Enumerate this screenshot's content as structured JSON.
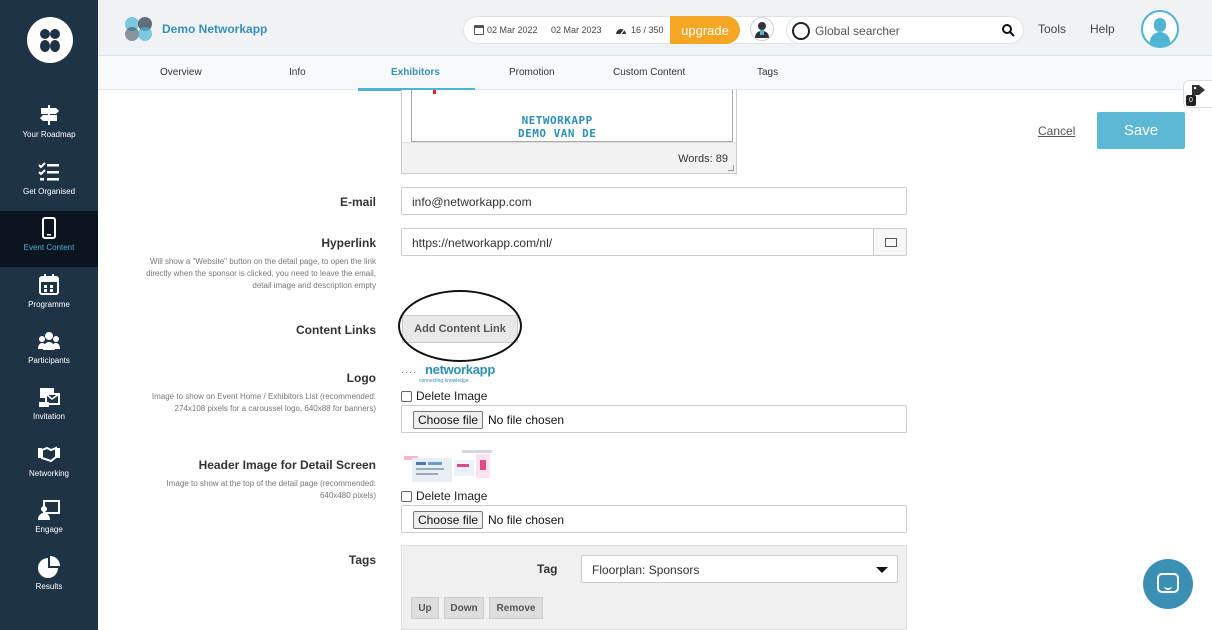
{
  "sidebar": {
    "items": [
      {
        "label": "Your Roadmap",
        "icon": "signpost-icon"
      },
      {
        "label": "Get Organised",
        "icon": "checklist-icon"
      },
      {
        "label": "Event Content",
        "icon": "mobile-icon",
        "active": true
      },
      {
        "label": "Programme",
        "icon": "calendar-icon"
      },
      {
        "label": "Participants",
        "icon": "users-icon"
      },
      {
        "label": "Invitation",
        "icon": "invitation-icon"
      },
      {
        "label": "Networking",
        "icon": "handshake-icon"
      },
      {
        "label": "Engage",
        "icon": "presentation-icon"
      },
      {
        "label": "Results",
        "icon": "pie-chart-icon"
      }
    ]
  },
  "topbar": {
    "app_name": "Demo Networkapp",
    "date_start": "02 Mar 2022",
    "date_end": "02 Mar 2023",
    "usage": "16 / 350",
    "upgrade_label": "upgrade",
    "search_placeholder": "Global searcher",
    "tools_label": "Tools",
    "help_label": "Help"
  },
  "tabs": [
    {
      "label": "Overview"
    },
    {
      "label": "Info"
    },
    {
      "label": "Exhibitors",
      "active": true
    },
    {
      "label": "Promotion"
    },
    {
      "label": "Custom Content"
    },
    {
      "label": "Tags"
    }
  ],
  "tag_flag": {
    "count": "0"
  },
  "editor": {
    "preview_line1": "NETWORKAPP",
    "preview_line2": "DEMO VAN DE",
    "word_count": "Words: 89"
  },
  "form": {
    "email": {
      "label": "E-mail",
      "value": "info@networkapp.com"
    },
    "hyperlink": {
      "label": "Hyperlink",
      "value": "https://networkapp.com/nl/",
      "help": "Will show a \"Website\" button on the detail page, to open the link directly when the sponsor is clicked, you need to leave the email, detail image and description empty"
    },
    "content_links": {
      "label": "Content Links",
      "button": "Add Content Link"
    },
    "logo": {
      "label": "Logo",
      "help": "Image to show on Event Home / Exhibitors List (recommended: 274x108 pixels for a caroussel logo, 640x88 for banners)",
      "image_text": "networkapp",
      "image_tagline": "connecting knowledge",
      "delete_label": "Delete Image",
      "choose_label": "Choose file",
      "no_file": "No file chosen"
    },
    "header_image": {
      "label": "Header Image for Detail Screen",
      "help": "Image to show at the top of the detail page (recommended: 640x480 pixels)",
      "delete_label": "Delete Image",
      "choose_label": "Choose file",
      "no_file": "No file chosen"
    },
    "tags": {
      "label": "Tags",
      "tag_label": "Tag",
      "selected": "Floorplan: Sponsors",
      "up": "Up",
      "down": "Down",
      "remove": "Remove"
    }
  },
  "actions": {
    "cancel": "Cancel",
    "save": "Save"
  },
  "colors": {
    "accent": "#4fb3d4",
    "sidebar": "#1f3346",
    "upgrade": "#f5a623",
    "save": "#5cb8d5"
  }
}
